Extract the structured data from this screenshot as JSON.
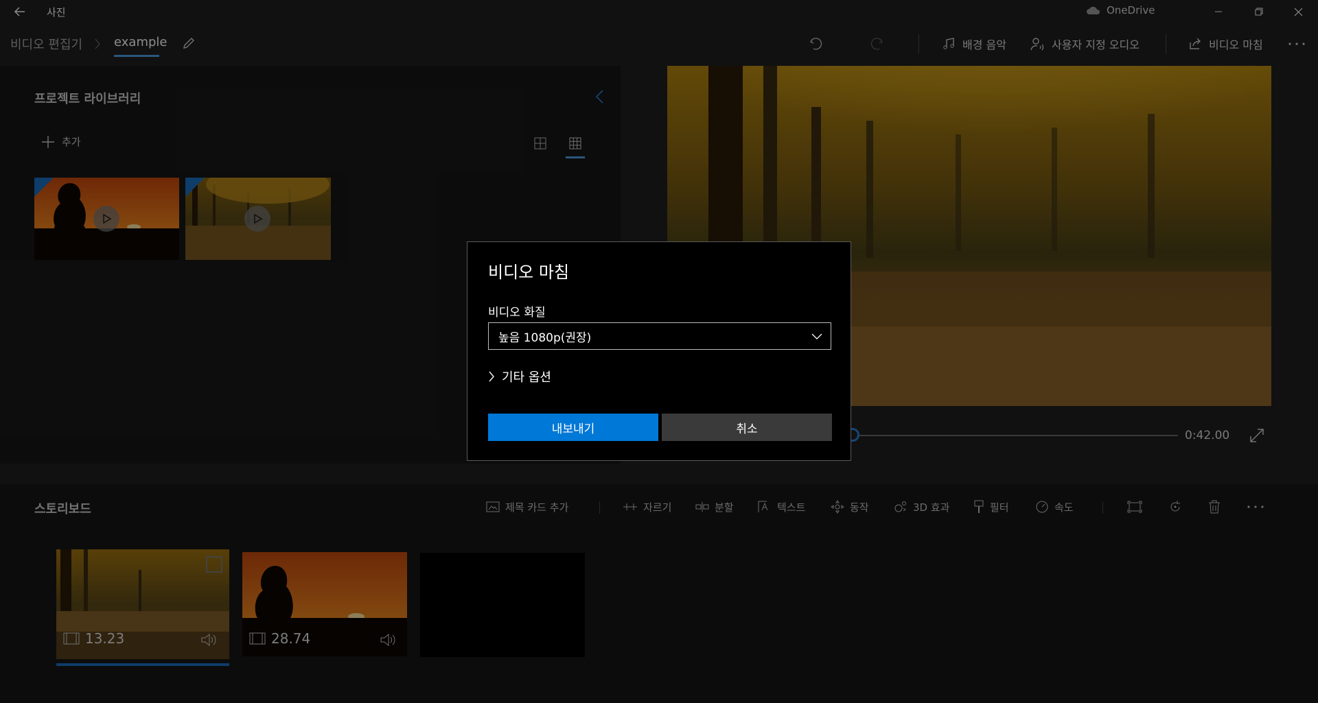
{
  "app": {
    "title": "사진",
    "onedrive_label": "OneDrive"
  },
  "breadcrumb": {
    "root": "비디오 편집기",
    "current": "example"
  },
  "toolbar": {
    "bg_music_label": "배경 음악",
    "custom_audio_label": "사용자 지정 오디오",
    "finish_video_label": "비디오 마침",
    "more_icon": "ellipsis-icon"
  },
  "library": {
    "title": "프로젝트 라이브러리",
    "add_label": "추가"
  },
  "preview": {
    "time": "0:42.00",
    "progress": 0.0
  },
  "storyboard": {
    "title": "스토리보드",
    "tools": {
      "title_card": "제목 카드 추가",
      "trim": "자르기",
      "split": "분할",
      "text": "텍스트",
      "motion": "동작",
      "effects_3d": "3D 효과",
      "filters": "필터",
      "speed": "속도"
    },
    "clips": [
      {
        "duration": "13.23"
      },
      {
        "duration": "28.74"
      }
    ]
  },
  "dialog": {
    "title": "비디오 마침",
    "quality_label": "비디오 화질",
    "quality_value": "높음 1080p(권장)",
    "more_options": "기타 옵션",
    "export_label": "내보내기",
    "cancel_label": "취소"
  },
  "colors": {
    "accent": "#0078d7",
    "underline": "#4e9fe6"
  }
}
